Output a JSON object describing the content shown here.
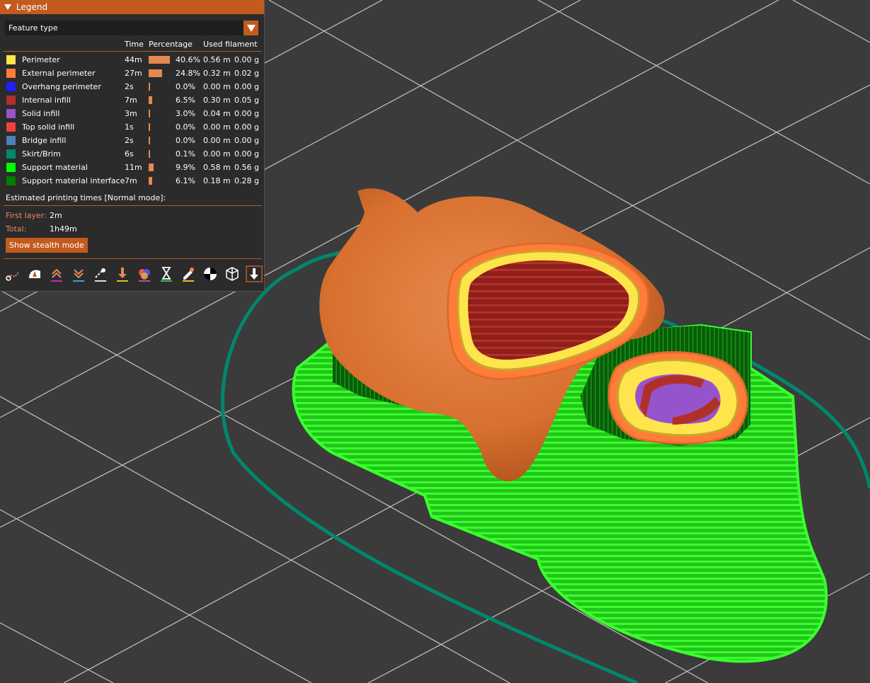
{
  "legend": {
    "title": "Legend",
    "view_type": "Feature type",
    "headers": {
      "time": "Time",
      "percentage": "Percentage",
      "filament": "Used filament"
    },
    "rows": [
      {
        "name": "Perimeter",
        "color": "#ffe54c",
        "time": "44m",
        "percent": "40.6%",
        "fraction": 0.406,
        "length": "0.56 m",
        "weight": "0.00 g"
      },
      {
        "name": "External perimeter",
        "color": "#ff7d38",
        "time": "27m",
        "percent": "24.8%",
        "fraction": 0.248,
        "length": "0.32 m",
        "weight": "0.02 g"
      },
      {
        "name": "Overhang perimeter",
        "color": "#1f1fff",
        "time": "2s",
        "percent": "0.0%",
        "fraction": 0.0,
        "length": "0.00 m",
        "weight": "0.00 g"
      },
      {
        "name": "Internal infill",
        "color": "#b03029",
        "time": "7m",
        "percent": "6.5%",
        "fraction": 0.065,
        "length": "0.30 m",
        "weight": "0.05 g"
      },
      {
        "name": "Solid infill",
        "color": "#9654cc",
        "time": "3m",
        "percent": "3.0%",
        "fraction": 0.03,
        "length": "0.04 m",
        "weight": "0.00 g"
      },
      {
        "name": "Top solid infill",
        "color": "#f04040",
        "time": "1s",
        "percent": "0.0%",
        "fraction": 0.0,
        "length": "0.00 m",
        "weight": "0.00 g"
      },
      {
        "name": "Bridge infill",
        "color": "#4d80ba",
        "time": "2s",
        "percent": "0.0%",
        "fraction": 0.0,
        "length": "0.00 m",
        "weight": "0.00 g"
      },
      {
        "name": "Skirt/Brim",
        "color": "#00876e",
        "time": "6s",
        "percent": "0.1%",
        "fraction": 0.001,
        "length": "0.00 m",
        "weight": "0.00 g"
      },
      {
        "name": "Support material",
        "color": "#00ff00",
        "time": "11m",
        "percent": "9.9%",
        "fraction": 0.099,
        "length": "0.58 m",
        "weight": "0.56 g"
      },
      {
        "name": "Support material interface",
        "color": "#008000",
        "time": "7m",
        "percent": "6.1%",
        "fraction": 0.061,
        "length": "0.18 m",
        "weight": "0.28 g"
      }
    ],
    "estimated_label": "Estimated printing times [Normal mode]:",
    "first_layer_label": "First layer:",
    "first_layer_value": "2m",
    "total_label": "Total:",
    "total_value": "1h49m",
    "stealth_button": "Show stealth mode",
    "toolbar_icons": [
      "travel-icon",
      "wipe-icon",
      "retractions-icon",
      "deretractions-icon",
      "seams-icon",
      "tool-changes-icon",
      "color-changes-icon",
      "pause-prints-icon",
      "custom-gcodes-icon",
      "center-of-gravity-icon",
      "shells-icon",
      "tool-marker-icon"
    ]
  },
  "colors": {
    "accent": "#c35b1e",
    "background": "#3b3b3b",
    "panel": "#2b2b2b"
  }
}
